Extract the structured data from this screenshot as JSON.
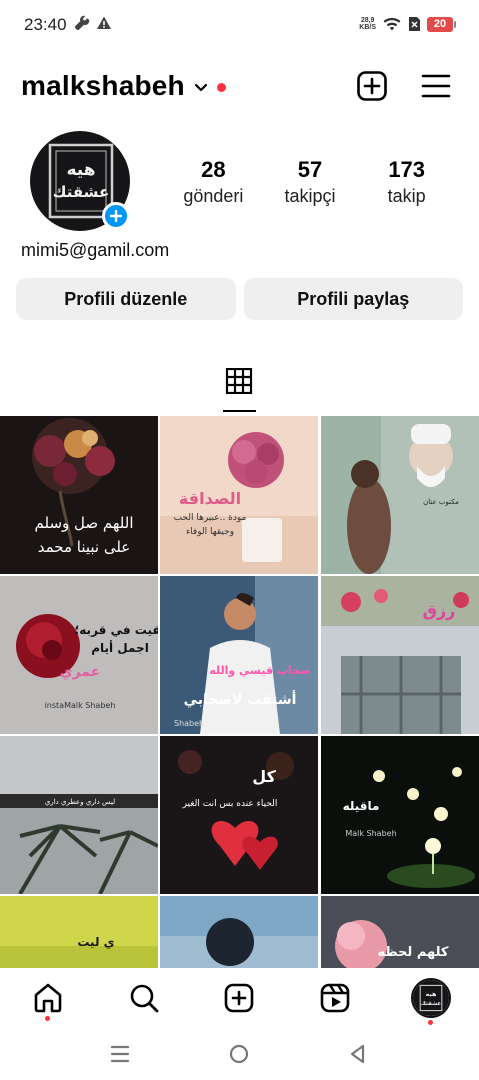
{
  "status_bar": {
    "time": "23:40",
    "icons": [
      "wrench-icon",
      "warning-icon"
    ],
    "net_speed_value": "28,9",
    "net_speed_unit": "KB/S",
    "right_icons": [
      "wifi-icon",
      "no-sim-icon"
    ],
    "battery": "20",
    "battery_color": "#e24b4b"
  },
  "header": {
    "username": "malkshabeh",
    "icons": [
      "chevron-down-icon",
      "create-plus-icon",
      "hamburger-menu-icon"
    ],
    "notification_color": "#ff3040"
  },
  "profile": {
    "avatar_text": [
      "هيه",
      "عشقتك"
    ],
    "badge_icon": "add-story-plus-icon",
    "badge_color": "#0095f6",
    "stats": [
      {
        "value": "28",
        "label": "gönderi"
      },
      {
        "value": "57",
        "label": "takipçi"
      },
      {
        "value": "173",
        "label": "takip"
      }
    ],
    "bio": "mimi5@gamil.com",
    "buttons": {
      "edit": "Profili düzenle",
      "share": "Profili paylaş"
    }
  },
  "tabs": {
    "active": "grid-icon"
  },
  "posts": [
    {
      "caption": [
        "اللهم صل وسلم",
        "على نبينا محمد"
      ]
    },
    {
      "caption": [
        "الصداقة",
        "مودة ..عبيرها الحب",
        "وجيقها الوفاء"
      ]
    },
    {
      "caption": [
        "مكتوب عتان"
      ]
    },
    {
      "caption": [
        "تقيت في قربه؛",
        "اجمل أيام",
        "عمري"
      ],
      "signature": "instaMalk Shabeh"
    },
    {
      "caption": [
        "صحاب قيسي والله",
        "أشتقت لاصحابي"
      ],
      "signature": "Shabeh"
    },
    {
      "caption": [
        "رزق"
      ]
    },
    {
      "caption": [
        "ليس داري وعطري داري"
      ]
    },
    {
      "caption": [
        "كل",
        "الحياء عنده بس انت الغير"
      ]
    },
    {
      "caption": [
        "Malk Shabeh"
      ]
    },
    {
      "caption": [
        "ي ليت"
      ]
    },
    {
      "caption": []
    },
    {
      "caption": [
        "كلهم لحظه"
      ]
    }
  ],
  "bottom_nav": {
    "items": [
      "home-icon",
      "search-icon",
      "create-icon",
      "reels-icon",
      "profile-avatar"
    ]
  },
  "system_nav": {
    "items": [
      "recents-icon",
      "home-circle-icon",
      "back-icon"
    ]
  }
}
